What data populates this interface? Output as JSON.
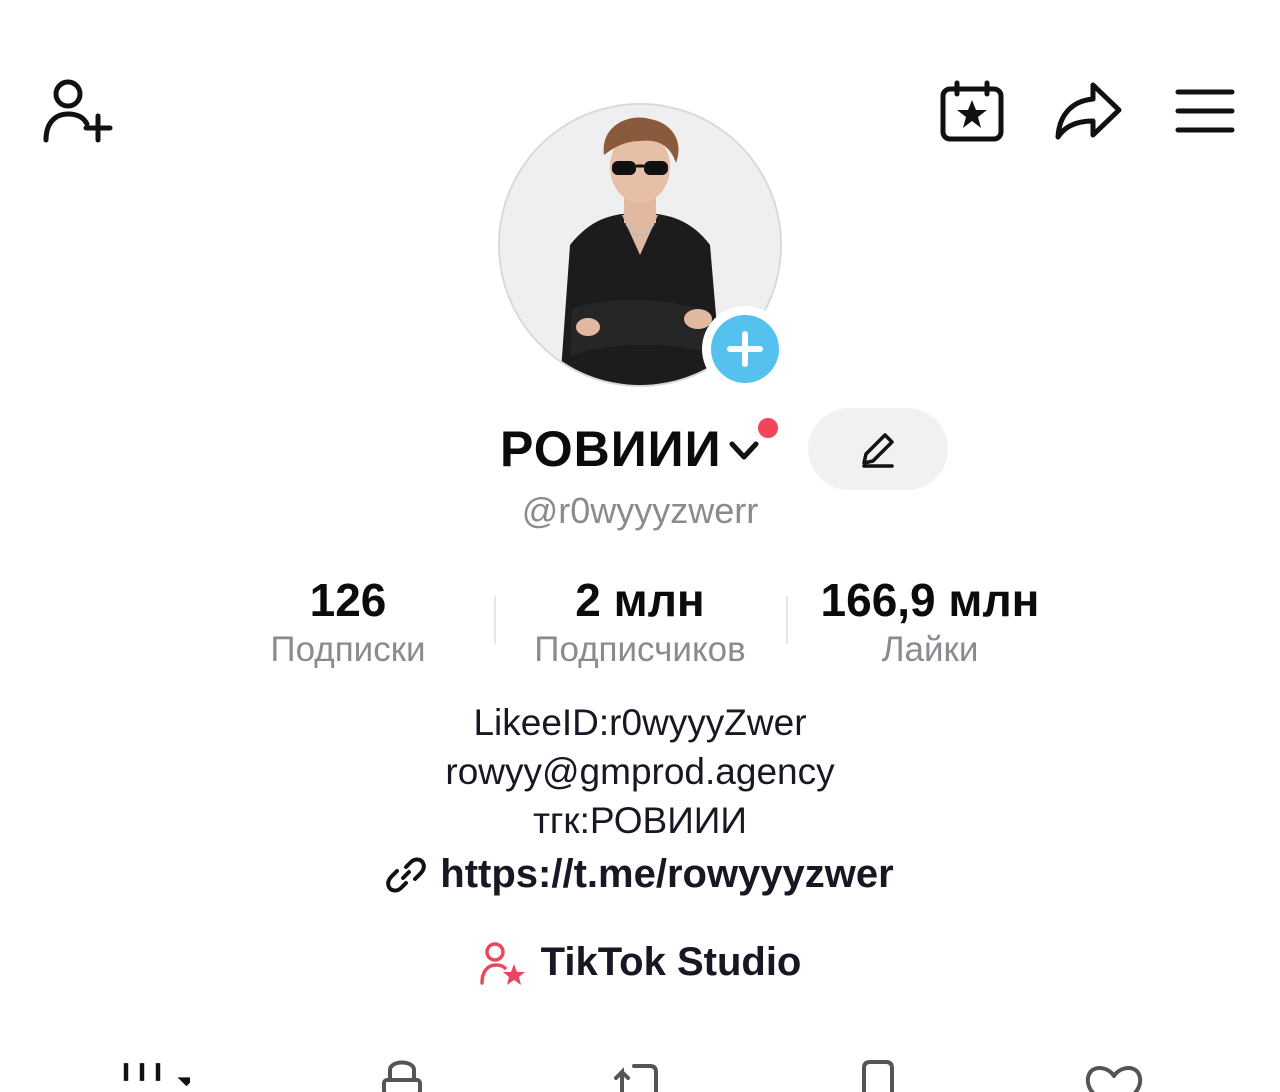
{
  "header": {
    "add_friend_icon": "person-plus-icon",
    "calendar_icon": "calendar-star-icon",
    "share_icon": "share-arrow-icon",
    "menu_icon": "hamburger-menu-icon"
  },
  "profile": {
    "display_name": "РОВИИИ",
    "username": "@r0wyyyzwerr",
    "avatar_add_icon": "plus-icon",
    "edit_icon": "pencil-icon"
  },
  "stats": [
    {
      "value": "126",
      "label": "Подписки"
    },
    {
      "value": "2 млн",
      "label": "Подписчиков"
    },
    {
      "value": "166,9 млн",
      "label": "Лайки"
    }
  ],
  "bio": {
    "line1": "LikeeID:r0wyyyZwer",
    "line2": "rowyy@gmprod.agency",
    "line3": "тгк:РОВИИИ"
  },
  "link": {
    "url": "https://t.me/rowyyyzwer",
    "icon": "link-icon"
  },
  "studio": {
    "label": "TikTok Studio",
    "icon": "creator-star-icon"
  },
  "tabs": [
    {
      "icon": "videos-grid-icon"
    },
    {
      "icon": "lock-icon"
    },
    {
      "icon": "repost-icon"
    },
    {
      "icon": "bookmark-icon"
    },
    {
      "icon": "heart-icon"
    }
  ],
  "colors": {
    "accent_blue": "#54c1ee",
    "notification_red": "#f0455b",
    "studio_pink": "#e8485f",
    "muted_text": "#8a8b91"
  }
}
